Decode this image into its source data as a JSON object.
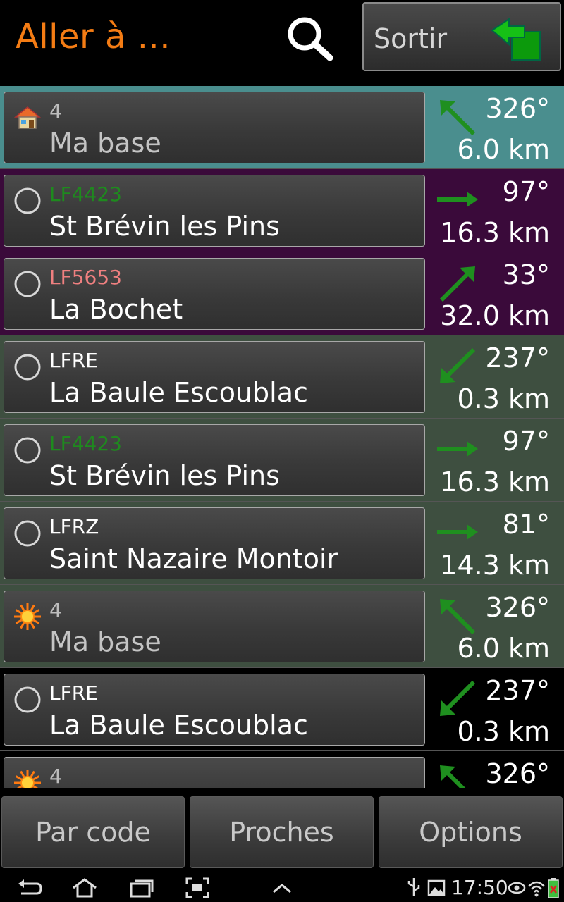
{
  "header": {
    "title": "Aller à ...",
    "exit_label": "Sortir"
  },
  "list": {
    "rows": [
      {
        "icon": "house-icon",
        "code": "4",
        "code_color": "#bdbdbd",
        "name": "Ma base",
        "name_color": "#c4c4c4",
        "bearing": "326°",
        "distance": "6.0 km",
        "bg": "#4a8e8e",
        "arrow": "up-left"
      },
      {
        "icon": "circle-icon",
        "code": "LF4423",
        "code_color": "#1e8a1e",
        "name": "St Brévin les Pins",
        "name_color": "#ffffff",
        "bearing": "97°",
        "distance": "16.3 km",
        "bg": "#3a0a3a",
        "arrow": "right"
      },
      {
        "icon": "circle-icon",
        "code": "LF5653",
        "code_color": "#f08080",
        "name": "La Bochet",
        "name_color": "#ffffff",
        "bearing": "33°",
        "distance": "32.0 km",
        "bg": "#3a0a3a",
        "arrow": "up-right"
      },
      {
        "icon": "circle-icon",
        "code": "LFRE",
        "code_color": "#ffffff",
        "name": "La Baule Escoublac",
        "name_color": "#ffffff",
        "bearing": "237°",
        "distance": "0.3 km",
        "bg": "#3e4f40",
        "arrow": "down-left"
      },
      {
        "icon": "circle-icon",
        "code": "LF4423",
        "code_color": "#1e8a1e",
        "name": "St Brévin les Pins",
        "name_color": "#ffffff",
        "bearing": "97°",
        "distance": "16.3 km",
        "bg": "#3e4f40",
        "arrow": "right"
      },
      {
        "icon": "circle-icon",
        "code": "LFRZ",
        "code_color": "#ffffff",
        "name": "Saint Nazaire Montoir",
        "name_color": "#ffffff",
        "bearing": "81°",
        "distance": "14.3 km",
        "bg": "#3e4f40",
        "arrow": "right"
      },
      {
        "icon": "sun-icon",
        "code": "4",
        "code_color": "#bdbdbd",
        "name": "Ma base",
        "name_color": "#c4c4c4",
        "bearing": "326°",
        "distance": "6.0 km",
        "bg": "#3e4f40",
        "arrow": "up-left"
      },
      {
        "icon": "circle-icon",
        "code": "LFRE",
        "code_color": "#ffffff",
        "name": "La Baule Escoublac",
        "name_color": "#ffffff",
        "bearing": "237°",
        "distance": "0.3 km",
        "bg": "#000000",
        "arrow": "down-left"
      },
      {
        "icon": "sun-icon",
        "code": "4",
        "code_color": "#bdbdbd",
        "name": "",
        "name_color": "#c4c4c4",
        "bearing": "326°",
        "distance": "",
        "bg": "#000000",
        "arrow": "up-left"
      }
    ]
  },
  "bottom": {
    "buttons": [
      "Par code",
      "Proches",
      "Options"
    ]
  },
  "system_bar": {
    "time": "17:50"
  },
  "colors": {
    "title": "#f47c14",
    "arrow_green": "#1f8f1f"
  }
}
